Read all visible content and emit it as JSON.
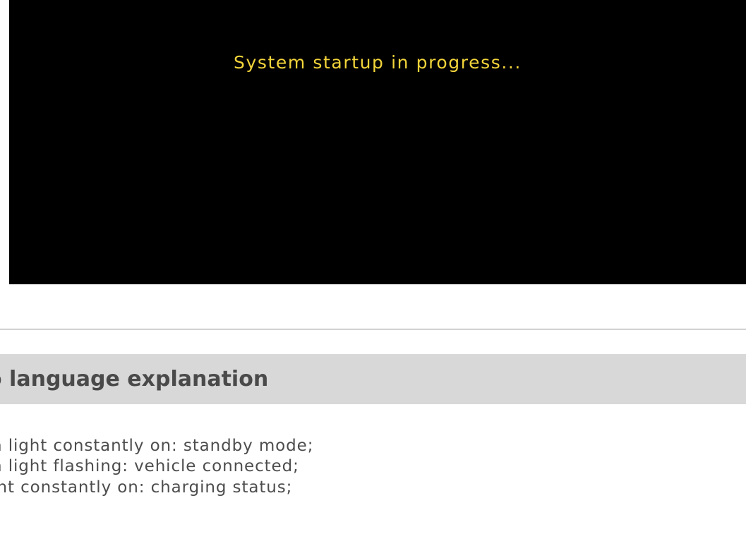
{
  "screen": {
    "message": "System startup in progress..."
  },
  "section": {
    "title": "o language explanation"
  },
  "explanations": [
    "n light constantly on: standby mode;",
    "n light flashing: vehicle connected;",
    "ght constantly on: charging status;"
  ],
  "colors": {
    "screen_background": "#000000",
    "message_text": "#f2d43a",
    "header_background": "#d8d8d8",
    "body_text": "#4d4d4d"
  }
}
